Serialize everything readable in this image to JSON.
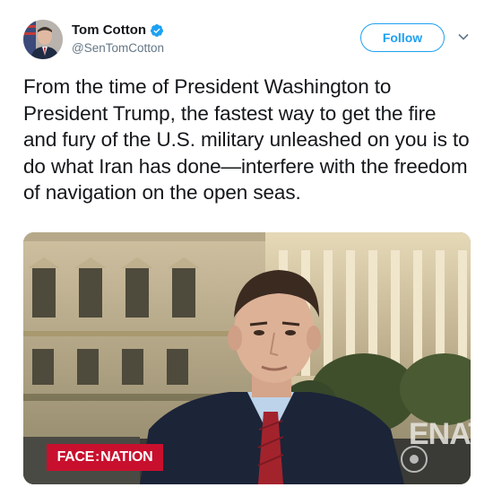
{
  "header": {
    "display_name": "Tom Cotton",
    "handle": "@SenTomCotton",
    "verified": true,
    "follow_label": "Follow"
  },
  "tweet": {
    "text": "From the time of President Washington to President Trump, the fastest way to get the fire and fury of the U.S. military unleashed on you is to do what Iran has done—interfere with the freedom of navigation on the open seas."
  },
  "media": {
    "show_name_left": "FACE",
    "show_name_right": "NATION",
    "background_text": "ENAT"
  },
  "colors": {
    "accent": "#1da1f2",
    "text": "#14171a",
    "secondary_text": "#657786",
    "show_red": "#c8102e"
  },
  "icons": {
    "verified": "verified-badge-icon",
    "caret": "chevron-down-icon"
  }
}
